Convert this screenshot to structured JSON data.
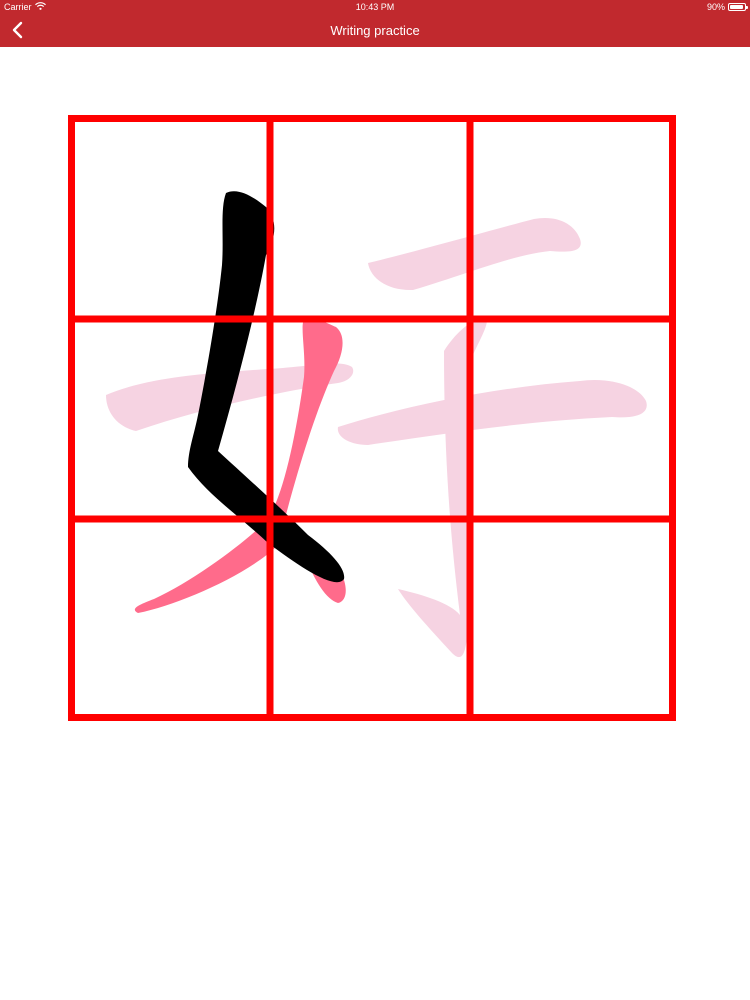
{
  "status_bar": {
    "carrier": "Carrier",
    "time": "10:43 PM",
    "battery_percent": "90%",
    "battery_level": 0.9,
    "wifi_icon": "wifi-icon",
    "battery_icon": "battery-icon"
  },
  "nav_bar": {
    "title": "Writing practice",
    "back_icon": "chevron-left-icon"
  },
  "colors": {
    "header_bg": "#c1292e",
    "grid_line": "#ff0000",
    "stroke_done": "#000000",
    "stroke_current": "#ff6b8b",
    "stroke_pending": "#f6d3e2"
  },
  "practice": {
    "character": "好",
    "total_strokes": 6,
    "completed_strokes": 1,
    "current_stroke": 2
  }
}
